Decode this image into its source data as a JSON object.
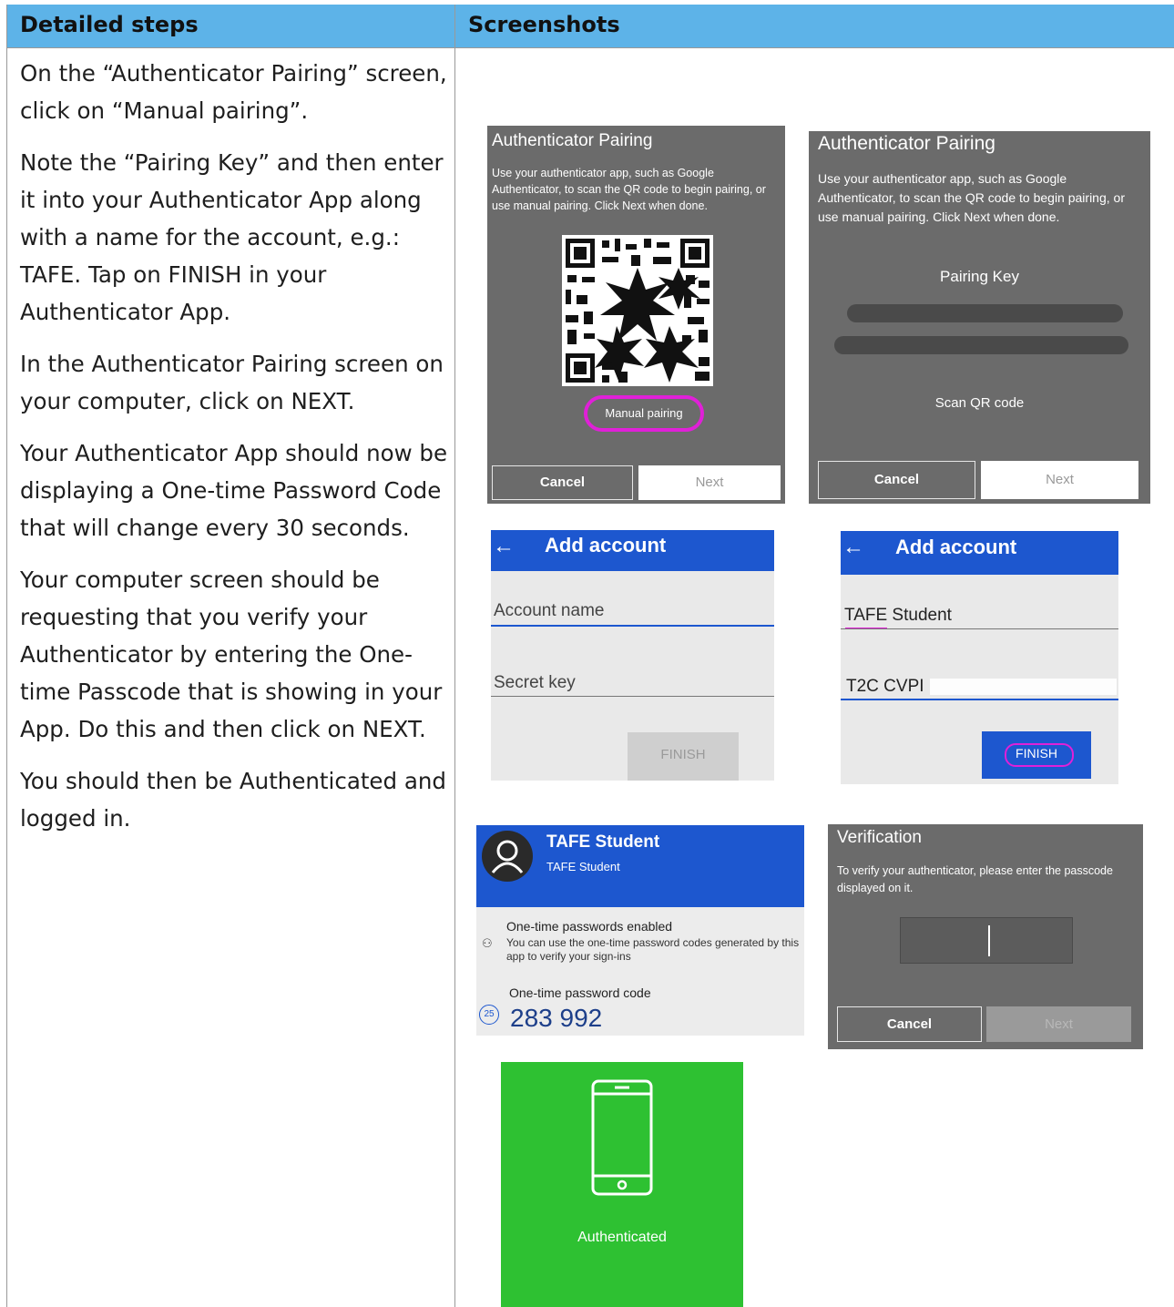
{
  "table": {
    "col1_header": "Detailed steps",
    "col2_header": "Screenshots"
  },
  "steps": [
    "On the “Authenticator Pairing” screen, click on “Manual pairing”.",
    "Note the “Pairing Key” and then enter it into your Authenticator App along with a name for the account, e.g.: TAFE. Tap on FINISH in your Authenticator App.",
    "In the Authenticator Pairing screen on your computer, click on NEXT.",
    "Your Authenticator App should now be displaying a One-time Password Code that will change every 30 seconds.",
    "Your computer screen should be requesting that you verify your Authenticator by entering the One-time Passcode that is showing in your App. Do this and then click on NEXT.",
    "You should then be Authenticated and logged in."
  ],
  "pairing_qr": {
    "title": "Authenticator Pairing",
    "description": "Use your authenticator app, such as Google Authenticator, to scan the QR code to begin pairing, or use manual pairing. Click Next when done.",
    "manual_pairing": "Manual pairing",
    "cancel": "Cancel",
    "next": "Next",
    "highlight_color": "#e020d8"
  },
  "pairing_key": {
    "title": "Authenticator Pairing",
    "description": "Use your authenticator app, such as Google Authenticator, to scan the QR code to begin pairing, or use manual pairing. Click Next when done.",
    "pairing_key_label": "Pairing Key",
    "scan_qr": "Scan QR code",
    "cancel": "Cancel",
    "next": "Next"
  },
  "add_account_empty": {
    "title": "Add account",
    "account_placeholder": "Account name",
    "secret_placeholder": "Secret key",
    "finish": "FINISH"
  },
  "add_account_filled": {
    "title": "Add account",
    "account_value": "TAFE Student",
    "secret_value": "T2C CVPI",
    "finish": "FINISH"
  },
  "otp_app": {
    "account_name": "TAFE Student",
    "account_sub": "TAFE Student",
    "enabled_title": "One-time passwords enabled",
    "enabled_desc": "You can use the one-time password codes generated by this app to verify your sign-ins",
    "code_label": "One-time password code",
    "code": "283 992",
    "timer": "25"
  },
  "verification": {
    "title": "Verification",
    "description": "To verify your authenticator, please enter the passcode displayed on it.",
    "cancel": "Cancel",
    "next": "Next"
  },
  "authenticated": {
    "label": "Authenticated",
    "bg_color": "#2ec132"
  }
}
